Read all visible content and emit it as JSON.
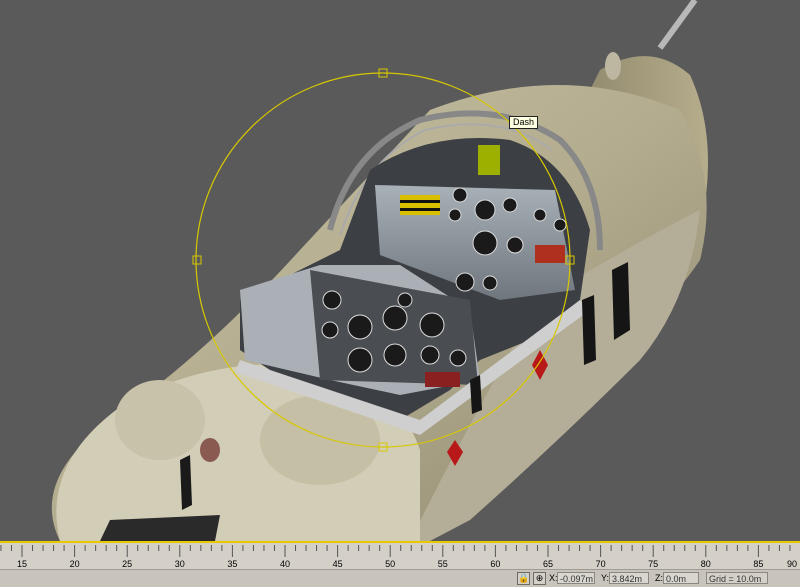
{
  "viewport": {
    "tooltip": "Dash",
    "background": "#5a5a5a",
    "gizmo_color": "#d8c800"
  },
  "timeline": {
    "ticks": [
      "15",
      "20",
      "25",
      "30",
      "35",
      "40",
      "45",
      "50",
      "55",
      "60",
      "65",
      "70",
      "75",
      "80",
      "85",
      "90"
    ],
    "accent": "#e8c800"
  },
  "status": {
    "x_label": "X:",
    "x_value": "-0.097m",
    "y_label": "Y:",
    "y_value": "3.842m",
    "z_label": "Z:",
    "z_value": "0.0m",
    "grid_text": "Grid = 10.0m"
  },
  "icons": [
    "lock-icon",
    "absolute-mode-icon"
  ]
}
